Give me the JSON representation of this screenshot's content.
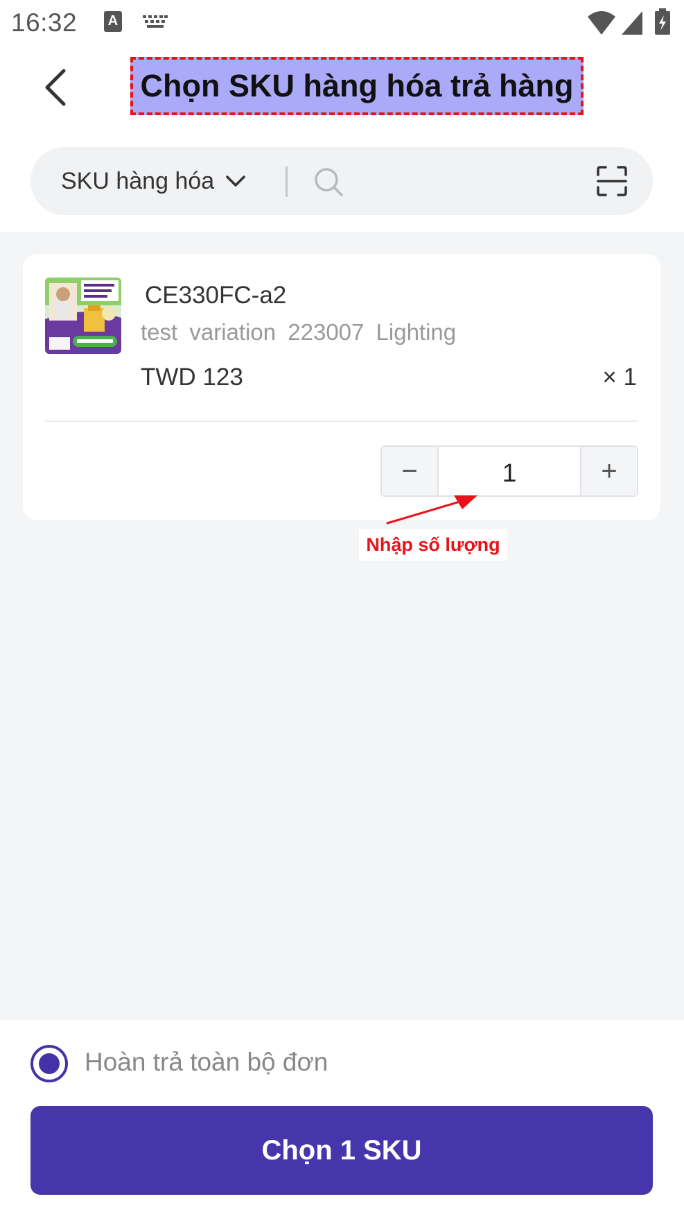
{
  "status_bar": {
    "time": "16:32",
    "keyboard_indicator": "A"
  },
  "header": {
    "title": "Chọn SKU hàng hóa trả hàng"
  },
  "search": {
    "type_label": "SKU hàng hóa",
    "placeholder": ""
  },
  "product": {
    "sku_code": "CE330FC-a2",
    "variation": "test variation 223007 Lighting",
    "price": "TWD 123",
    "quantity_multiplier": "× 1",
    "stepper": {
      "minus": "−",
      "value": "1",
      "plus": "+"
    }
  },
  "annotation": {
    "label": "Nhập số lượng",
    "color": "#e8121a"
  },
  "footer": {
    "radio_label": "Hoàn trả toàn bộ đơn",
    "radio_selected": true,
    "primary_button": "Chọn 1 SKU"
  },
  "colors": {
    "accent": "#4736ab",
    "background": "#f4f5f7",
    "title_highlight": "#aaaaf8"
  }
}
